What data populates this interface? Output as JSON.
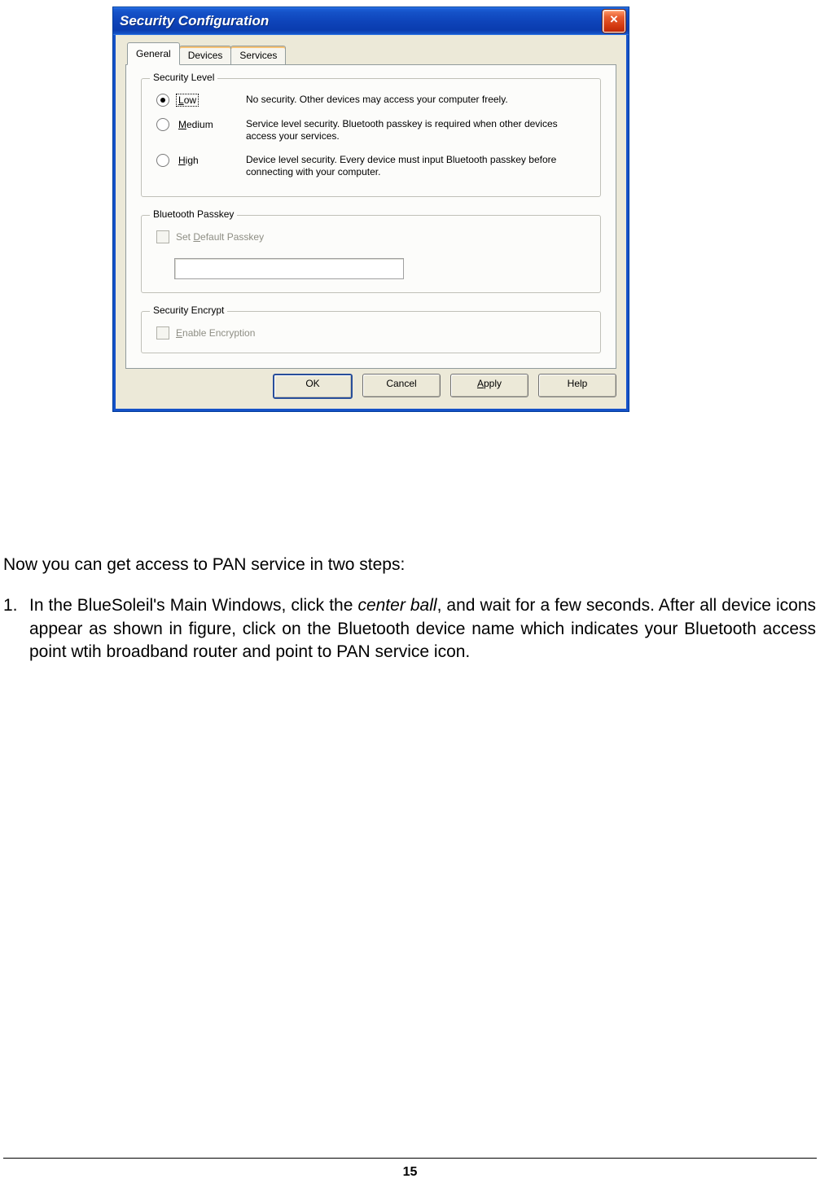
{
  "dialog": {
    "title": "Security Configuration",
    "tabs": [
      "General",
      "Devices",
      "Services"
    ],
    "active_tab": 0,
    "security_level": {
      "legend": "Security Level",
      "selected": 0,
      "options": [
        {
          "mnemonic": "L",
          "rest": "ow",
          "desc": "No security. Other devices may access your computer freely."
        },
        {
          "mnemonic": "M",
          "rest": "edium",
          "desc": "Service level security. Bluetooth passkey is required when other devices access your services."
        },
        {
          "mnemonic": "H",
          "rest": "igh",
          "desc": "Device level security. Every device must input Bluetooth passkey before connecting with your computer."
        }
      ]
    },
    "passkey": {
      "legend": "Bluetooth Passkey",
      "check_pre": "Set ",
      "check_mnemonic": "D",
      "check_post": "efault Passkey",
      "value": ""
    },
    "encrypt": {
      "legend": "Security Encrypt",
      "check_mnemonic": "E",
      "check_post": "nable Encryption"
    },
    "buttons": {
      "ok": "OK",
      "cancel": "Cancel",
      "apply_mnemonic": "A",
      "apply_post": "pply",
      "help": "Help"
    }
  },
  "doc": {
    "intro": "Now you can get access to PAN service in two steps:",
    "step1_pre": "In the BlueSoleil's Main Windows, click the ",
    "step1_em": "center ball",
    "step1_post": ", and wait for a few seconds. After all device icons appear as shown in figure, click on the Bluetooth device name which indicates your Bluetooth access point wtih broadband router and point to PAN service icon.",
    "page_number": "15"
  }
}
